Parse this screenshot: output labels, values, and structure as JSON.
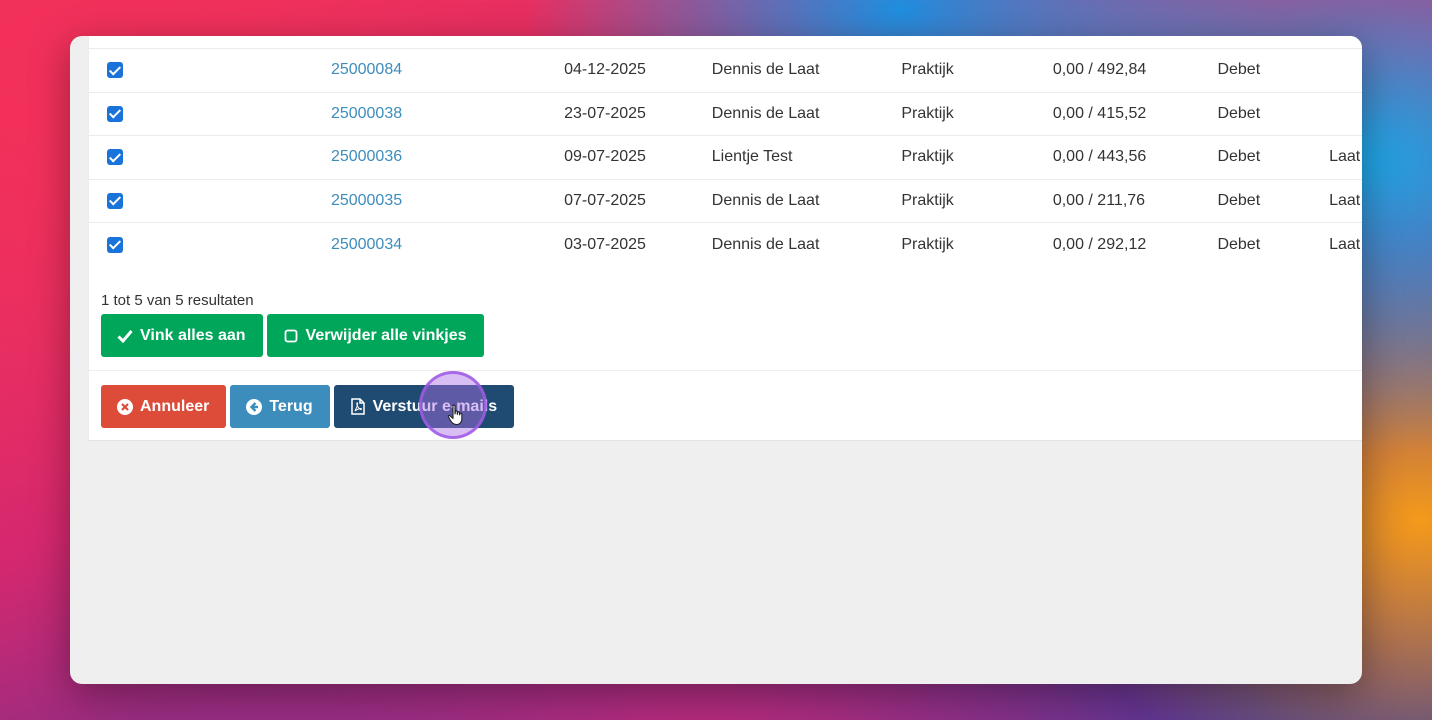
{
  "rows": [
    {
      "checked": true,
      "number": "25000084",
      "date": "04-12-2025",
      "name": "Dennis de Laat",
      "type": "Praktijk",
      "amount": "0,00 / 492,84",
      "side": "Debet",
      "extra": ""
    },
    {
      "checked": true,
      "number": "25000038",
      "date": "23-07-2025",
      "name": "Dennis de Laat",
      "type": "Praktijk",
      "amount": "0,00 / 415,52",
      "side": "Debet",
      "extra": ""
    },
    {
      "checked": true,
      "number": "25000036",
      "date": "09-07-2025",
      "name": "Lientje Test",
      "type": "Praktijk",
      "amount": "0,00 / 443,56",
      "side": "Debet",
      "extra": "Laat"
    },
    {
      "checked": true,
      "number": "25000035",
      "date": "07-07-2025",
      "name": "Dennis de Laat",
      "type": "Praktijk",
      "amount": "0,00 / 211,76",
      "side": "Debet",
      "extra": "Laat"
    },
    {
      "checked": true,
      "number": "25000034",
      "date": "03-07-2025",
      "name": "Dennis de Laat",
      "type": "Praktijk",
      "amount": "0,00 / 292,12",
      "side": "Debet",
      "extra": "Laat"
    }
  ],
  "pagination": {
    "summary": "1 tot 5 van 5 resultaten"
  },
  "selection_buttons": {
    "check_all": "Vink alles aan",
    "uncheck_all": "Verwijder alle vinkjes"
  },
  "action_buttons": {
    "cancel": "Annuleer",
    "back": "Terug",
    "send": "Verstuur e-mails"
  },
  "icons": {
    "check_all": "check-icon",
    "uncheck_all": "square-icon",
    "cancel": "times-circle-icon",
    "back": "arrow-circle-left-icon",
    "send": "file-pdf-icon",
    "cursor": "hand-pointer-icon"
  },
  "colors": {
    "green": "#00a65a",
    "red": "#dd4b39",
    "blue": "#3c8dbc",
    "navy": "#1f4a72",
    "link": "#3c8dbc",
    "checkbox": "#1a73d9"
  }
}
